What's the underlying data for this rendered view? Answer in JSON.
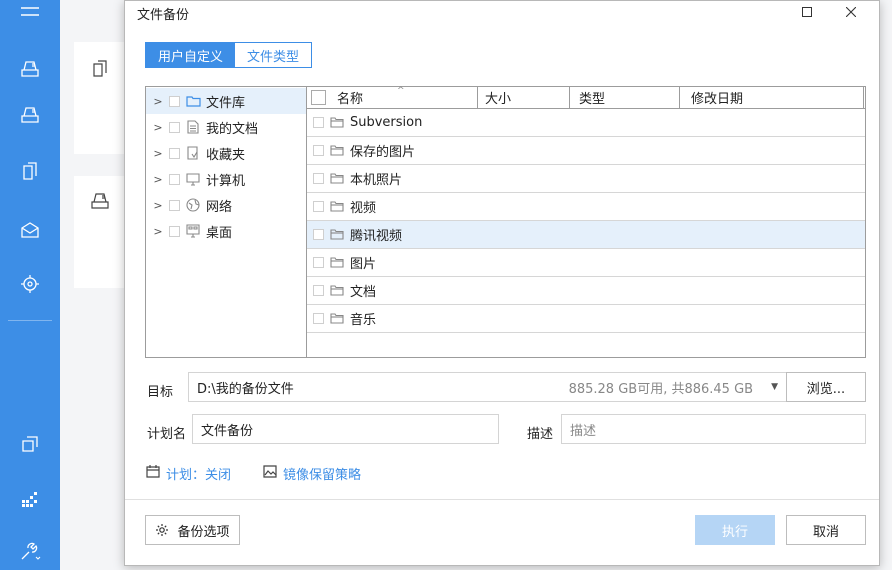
{
  "dialog": {
    "title": "文件备份",
    "segment": {
      "custom": "用户自定义",
      "filetype": "文件类型"
    },
    "tree": [
      {
        "label": "文件库",
        "icon": "folder-icon",
        "selected": true
      },
      {
        "label": "我的文档",
        "icon": "document-icon"
      },
      {
        "label": "收藏夹",
        "icon": "favorites-icon"
      },
      {
        "label": "计算机",
        "icon": "computer-icon"
      },
      {
        "label": "网络",
        "icon": "network-icon"
      },
      {
        "label": "桌面",
        "icon": "desktop-icon"
      }
    ],
    "columns": {
      "name": "名称",
      "size": "大小",
      "type": "类型",
      "modified": "修改日期"
    },
    "files": [
      {
        "name": "Subversion"
      },
      {
        "name": "保存的图片"
      },
      {
        "name": "本机照片"
      },
      {
        "name": "视频"
      },
      {
        "name": "腾讯视频",
        "highlighted": true
      },
      {
        "name": "图片"
      },
      {
        "name": "文档"
      },
      {
        "name": "音乐"
      }
    ],
    "target": {
      "label": "目标",
      "path": "D:\\我的备份文件",
      "space": "885.28 GB可用, 共886.45 GB",
      "browse": "浏览..."
    },
    "plan": {
      "label": "计划名",
      "value": "文件备份"
    },
    "description": {
      "label": "描述",
      "placeholder": "描述"
    },
    "schedule_link": "计划：关闭",
    "mirror_link": "镜像保留策略",
    "options_button": "备份选项",
    "execute_button": "执行",
    "cancel_button": "取消"
  },
  "colors": {
    "accent": "#3d8ee6",
    "disabled_primary": "#b5d5f5",
    "highlight": "#e5f0fb"
  }
}
